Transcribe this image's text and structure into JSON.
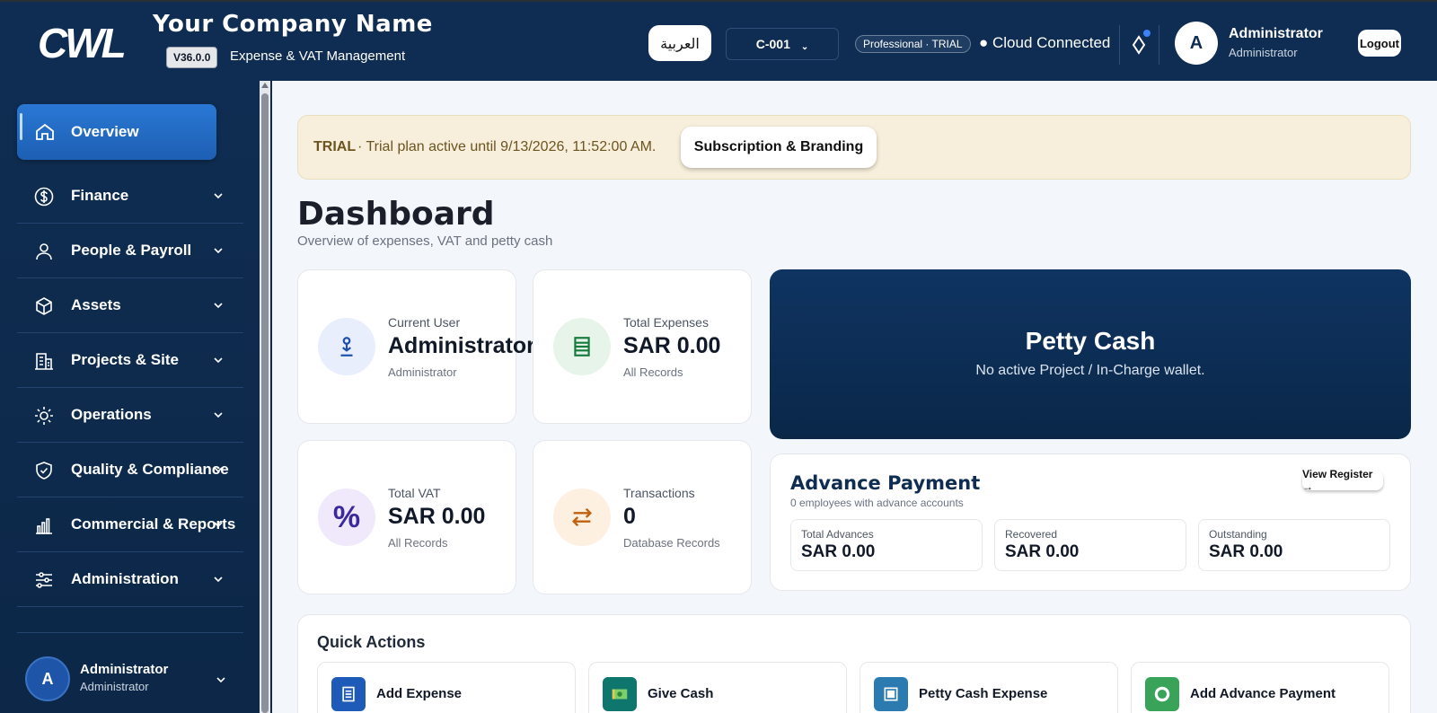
{
  "header": {
    "logo_text": "CWL",
    "company_name": "Your Company Name",
    "version": "V36.0.0",
    "tagline": "Expense & VAT Management",
    "language_button": "العربية",
    "company_code": "C-001",
    "plan_badge": "Professional · TRIAL",
    "cloud_status": "● Cloud Connected",
    "user": {
      "initial": "A",
      "name": "Administrator",
      "role": "Administrator"
    },
    "logout_label": "Logout"
  },
  "sidebar": {
    "active_item": "Overview",
    "items": [
      {
        "label": "Finance",
        "icon": "dollar-circle-icon"
      },
      {
        "label": "People & Payroll",
        "icon": "person-icon"
      },
      {
        "label": "Assets",
        "icon": "cube-icon"
      },
      {
        "label": "Projects & Site",
        "icon": "building-icon"
      },
      {
        "label": "Operations",
        "icon": "sun-gear-icon"
      },
      {
        "label": "Quality & Compliance",
        "icon": "shield-check-icon"
      },
      {
        "label": "Commercial & Reports",
        "icon": "bar-chart-icon"
      },
      {
        "label": "Administration",
        "icon": "sliders-icon"
      }
    ],
    "footer_user": {
      "initial": "A",
      "name": "Administrator",
      "role": "Administrator"
    }
  },
  "main": {
    "trial_banner": {
      "tag": "TRIAL",
      "text": "· Trial plan active until 9/13/2026, 11:52:00 AM.",
      "button": "Subscription & Branding"
    },
    "title": "Dashboard",
    "subtitle": "Overview of expenses, VAT and petty cash",
    "stats": [
      {
        "label": "Current User",
        "value": "Administrator",
        "sub": "Administrator",
        "icon": "user-pin-icon"
      },
      {
        "label": "Total Expenses",
        "value": "SAR 0.00",
        "sub": "All Records",
        "icon": "ledger-icon"
      },
      {
        "label": "Total VAT",
        "value": "SAR 0.00",
        "sub": "All Records",
        "icon": "percent-icon"
      },
      {
        "label": "Transactions",
        "value": "0",
        "sub": "Database Records",
        "icon": "swap-arrows-icon"
      }
    ],
    "petty_cash": {
      "title": "Petty Cash",
      "subtitle": "No active Project / In-Charge wallet."
    },
    "advance_payment": {
      "title": "Advance Payment",
      "subtitle": "0 employees with advance accounts",
      "view_register": "View Register →",
      "boxes": [
        {
          "label": "Total Advances",
          "value": "SAR 0.00"
        },
        {
          "label": "Recovered",
          "value": "SAR 0.00"
        },
        {
          "label": "Outstanding",
          "value": "SAR 0.00"
        }
      ]
    },
    "quick_actions": {
      "title": "Quick Actions",
      "items": [
        {
          "label": "Add Expense",
          "icon": "document-icon",
          "color": "#1e5bb8"
        },
        {
          "label": "Give Cash",
          "icon": "banknote-icon",
          "color": "#0f766e"
        },
        {
          "label": "Petty Cash Expense",
          "icon": "wallet-icon",
          "color": "#2b7bb0"
        },
        {
          "label": "Add Advance Payment",
          "icon": "coin-icon",
          "color": "#3aa35a"
        }
      ]
    }
  },
  "colors": {
    "header_bg": "#0f2d52",
    "sidebar_active": "#2a78d4",
    "trial_bg": "#f7efdb",
    "petty_bg": "#0f3462"
  }
}
